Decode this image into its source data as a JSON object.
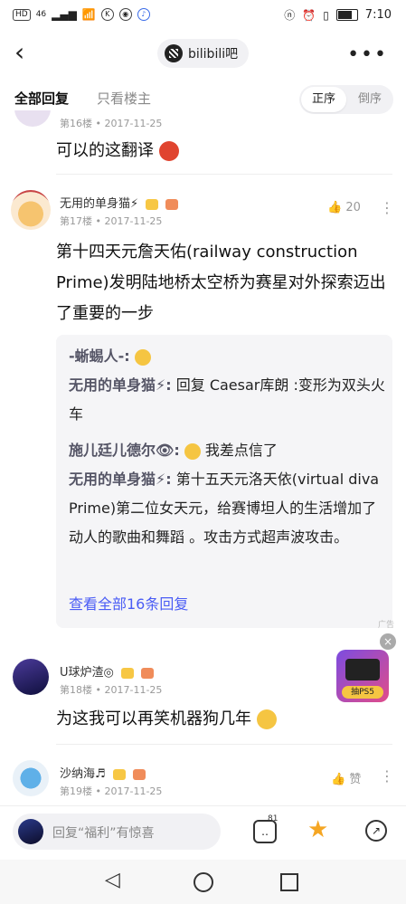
{
  "status": {
    "left_labels": [
      "HD",
      "46",
      "K"
    ],
    "time": "7:10"
  },
  "header": {
    "forum_name": "bilibili吧"
  },
  "tabs": {
    "all": "全部回复",
    "host_only": "只看楼主",
    "sort_asc": "正序",
    "sort_desc": "倒序"
  },
  "posts": [
    {
      "floor": "第16楼",
      "date": "2017-11-25",
      "text": "可以的这翻译"
    },
    {
      "user": "无用的单身猫⚡",
      "floor": "第17楼",
      "date": "2017-11-25",
      "likes": "20",
      "text": "第十四天元詹天佑(railway construction Prime)发明陆地桥太空桥为赛星对外探索迈出了重要的一步",
      "replies": [
        {
          "name": "-蜥蜴人-:",
          "text": ""
        },
        {
          "name": "无用的单身猫⚡:",
          "text": "回复 Caesar库朗 :变形为双头火车"
        },
        {
          "name": "施儿廷儿德尔👁:",
          "text": "我差点信了"
        },
        {
          "name": "无用的单身猫⚡:",
          "text": "第十五天元洛天依(virtual diva Prime)第二位女天元，给赛博坦人的生活增加了动人的歌曲和舞蹈 。攻击方式超声波攻击。"
        }
      ],
      "view_all": "查看全部16条回复"
    },
    {
      "user": "U球炉渣◎",
      "floor": "第18楼",
      "date": "2017-11-25",
      "text": "为这我可以再笑机器狗几年"
    },
    {
      "user": "沙纳海♬",
      "floor": "第19楼",
      "date": "2017-11-25",
      "like_label": "赞"
    }
  ],
  "ad": {
    "tag": "广告",
    "label": "抽PS5"
  },
  "bottom": {
    "reply_placeholder": "回复“福利”有惊喜",
    "comment_count": "81"
  },
  "colors": {
    "accent": "#4a5cf5",
    "star": "#f5a623"
  }
}
